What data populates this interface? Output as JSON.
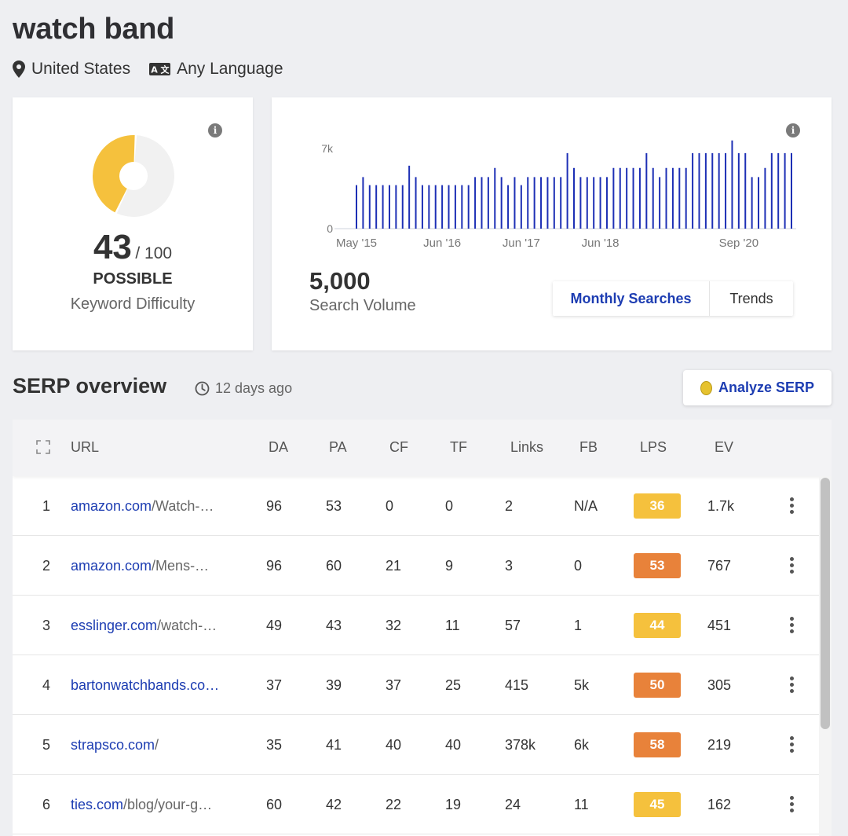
{
  "keyword": "watch band",
  "location": "United States",
  "language": "Any Language",
  "difficulty": {
    "score": "43",
    "max": "/ 100",
    "label": "POSSIBLE",
    "caption": "Keyword Difficulty",
    "fraction": 0.43,
    "color": "#f5c13d"
  },
  "search_volume": {
    "value": "5,000",
    "caption": "Search Volume",
    "tabs": [
      "Monthly Searches",
      "Trends"
    ]
  },
  "chart_data": {
    "type": "bar",
    "color": "#1d2fb5",
    "y_ticks": [
      "7k",
      "0"
    ],
    "ylim": [
      0,
      7000
    ],
    "x_tick_labels": [
      "May '15",
      "Jun '16",
      "Jun '17",
      "Jun '18",
      "Sep '20"
    ],
    "x_tick_indices": [
      0,
      13,
      25,
      37,
      58
    ],
    "values": [
      3800,
      4500,
      3800,
      3800,
      3800,
      3800,
      3800,
      3800,
      5500,
      4500,
      3800,
      3800,
      3800,
      3800,
      3800,
      3800,
      3800,
      3800,
      4500,
      4500,
      4500,
      5300,
      4500,
      3800,
      4500,
      3800,
      4500,
      4500,
      4500,
      4500,
      4500,
      4500,
      6600,
      5300,
      4500,
      4500,
      4500,
      4500,
      4500,
      5300,
      5300,
      5300,
      5300,
      5300,
      6600,
      5300,
      4500,
      5300,
      5300,
      5300,
      5300,
      6600,
      6600,
      6600,
      6600,
      6600,
      6600,
      7700,
      6600,
      6600,
      4500,
      4500,
      5300,
      6600,
      6600,
      6600,
      6600
    ]
  },
  "serp": {
    "title": "SERP overview",
    "time": "12 days ago",
    "analyze_label": "Analyze SERP",
    "columns": [
      "URL",
      "DA",
      "PA",
      "CF",
      "TF",
      "Links",
      "FB",
      "LPS",
      "EV"
    ],
    "rows": [
      {
        "rank": "1",
        "domain": "amazon.com",
        "path": "/Watch-…",
        "da": "96",
        "pa": "53",
        "cf": "0",
        "tf": "0",
        "links": "2",
        "fb": "N/A",
        "lps": "36",
        "lps_color": "#f5c13d",
        "ev": "1.7k"
      },
      {
        "rank": "2",
        "domain": "amazon.com",
        "path": "/Mens-…",
        "da": "96",
        "pa": "60",
        "cf": "21",
        "tf": "9",
        "links": "3",
        "fb": "0",
        "lps": "53",
        "lps_color": "#e8823a",
        "ev": "767"
      },
      {
        "rank": "3",
        "domain": "esslinger.com",
        "path": "/watch-…",
        "da": "49",
        "pa": "43",
        "cf": "32",
        "tf": "11",
        "links": "57",
        "fb": "1",
        "lps": "44",
        "lps_color": "#f5c13d",
        "ev": "451"
      },
      {
        "rank": "4",
        "domain": "bartonwatchbands.co…",
        "path": "",
        "da": "37",
        "pa": "39",
        "cf": "37",
        "tf": "25",
        "links": "415",
        "fb": "5k",
        "lps": "50",
        "lps_color": "#e8823a",
        "ev": "305"
      },
      {
        "rank": "5",
        "domain": "strapsco.com",
        "path": "/",
        "da": "35",
        "pa": "41",
        "cf": "40",
        "tf": "40",
        "links": "378k",
        "fb": "6k",
        "lps": "58",
        "lps_color": "#e8823a",
        "ev": "219"
      },
      {
        "rank": "6",
        "domain": "ties.com",
        "path": "/blog/your-g…",
        "da": "60",
        "pa": "42",
        "cf": "22",
        "tf": "19",
        "links": "24",
        "fb": "11",
        "lps": "45",
        "lps_color": "#f5c13d",
        "ev": "162"
      }
    ]
  }
}
